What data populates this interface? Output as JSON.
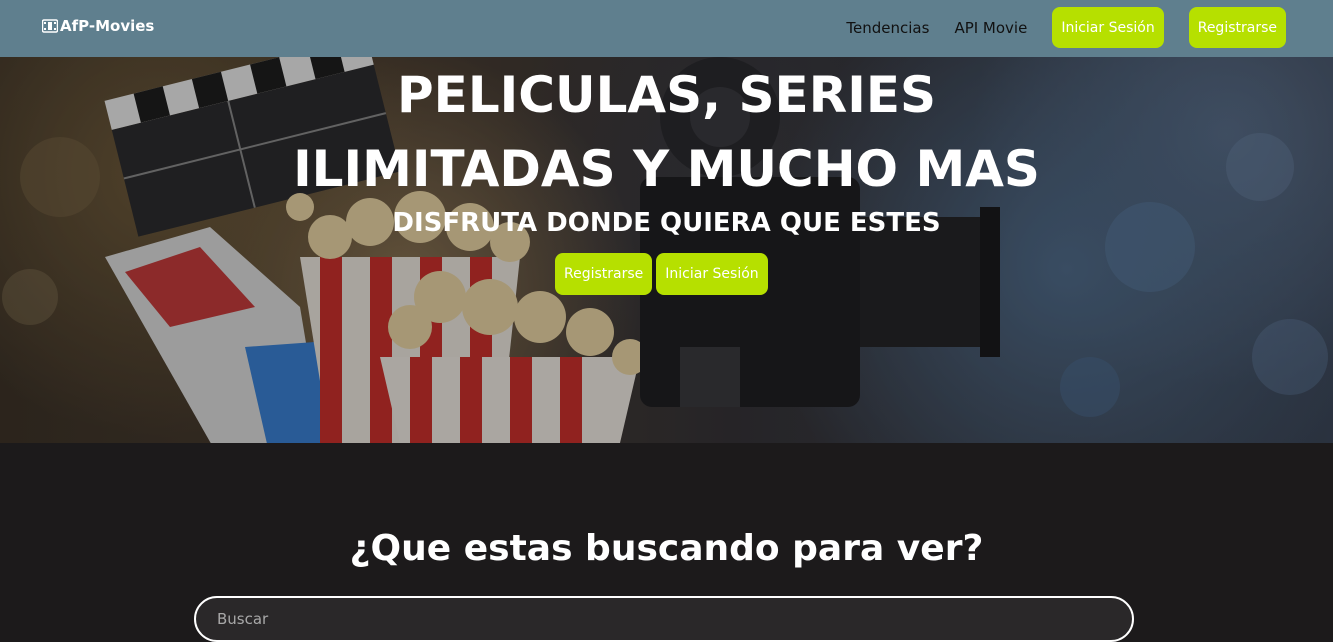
{
  "navbar": {
    "brand": "AfP-Movies",
    "brand_icon": "film-reel-icon",
    "links": [
      "Tendencias",
      "API Movie"
    ],
    "login_label": "Iniciar Sesión",
    "register_label": "Registrarse",
    "bg_color": "#5f7f8e",
    "accent_color": "#b6e000"
  },
  "hero": {
    "title_line1": "PELICULAS, SERIES",
    "title_line2": "ILIMITADAS Y MUCHO MAS",
    "subtitle": "DISFRUTA DONDE QUIERA QUE ESTES",
    "register_label": "Registrarse",
    "login_label": "Iniciar Sesión"
  },
  "search": {
    "title": "¿Que estas buscando para ver?",
    "placeholder": "Buscar"
  }
}
